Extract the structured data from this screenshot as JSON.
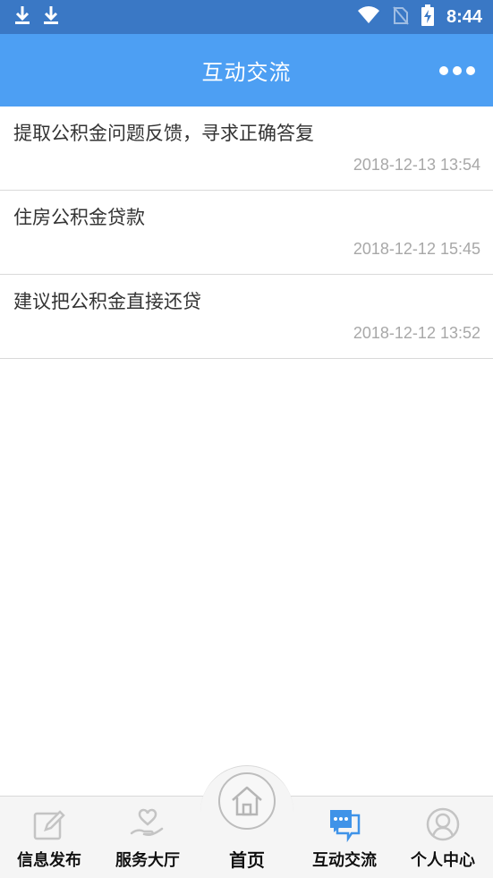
{
  "status_bar": {
    "time": "8:44",
    "icons": [
      "download-icon",
      "download-icon",
      "wifi-icon",
      "no-sim-icon",
      "battery-charging-icon"
    ]
  },
  "header": {
    "title": "互动交流",
    "more_icon": "more-dots-icon"
  },
  "list": [
    {
      "title": "提取公积金问题反馈，寻求正确答复",
      "date": "2018-12-13 13:54"
    },
    {
      "title": "住房公积金贷款",
      "date": "2018-12-12 15:45"
    },
    {
      "title": "建议把公积金直接还贷",
      "date": "2018-12-12 13:52"
    }
  ],
  "tabs": [
    {
      "label": "信息发布",
      "icon": "edit-icon"
    },
    {
      "label": "服务大厅",
      "icon": "hand-heart-icon"
    },
    {
      "label": "首页",
      "icon": "home-icon"
    },
    {
      "label": "互动交流",
      "icon": "chat-icon",
      "active": true
    },
    {
      "label": "个人中心",
      "icon": "user-icon"
    }
  ],
  "colors": {
    "status_bar": "#3a78c5",
    "app_bar": "#4d9ff3",
    "active_icon": "#3f93e8",
    "inactive_icon": "#c4c4c4",
    "date_text": "#a8a8a8"
  }
}
